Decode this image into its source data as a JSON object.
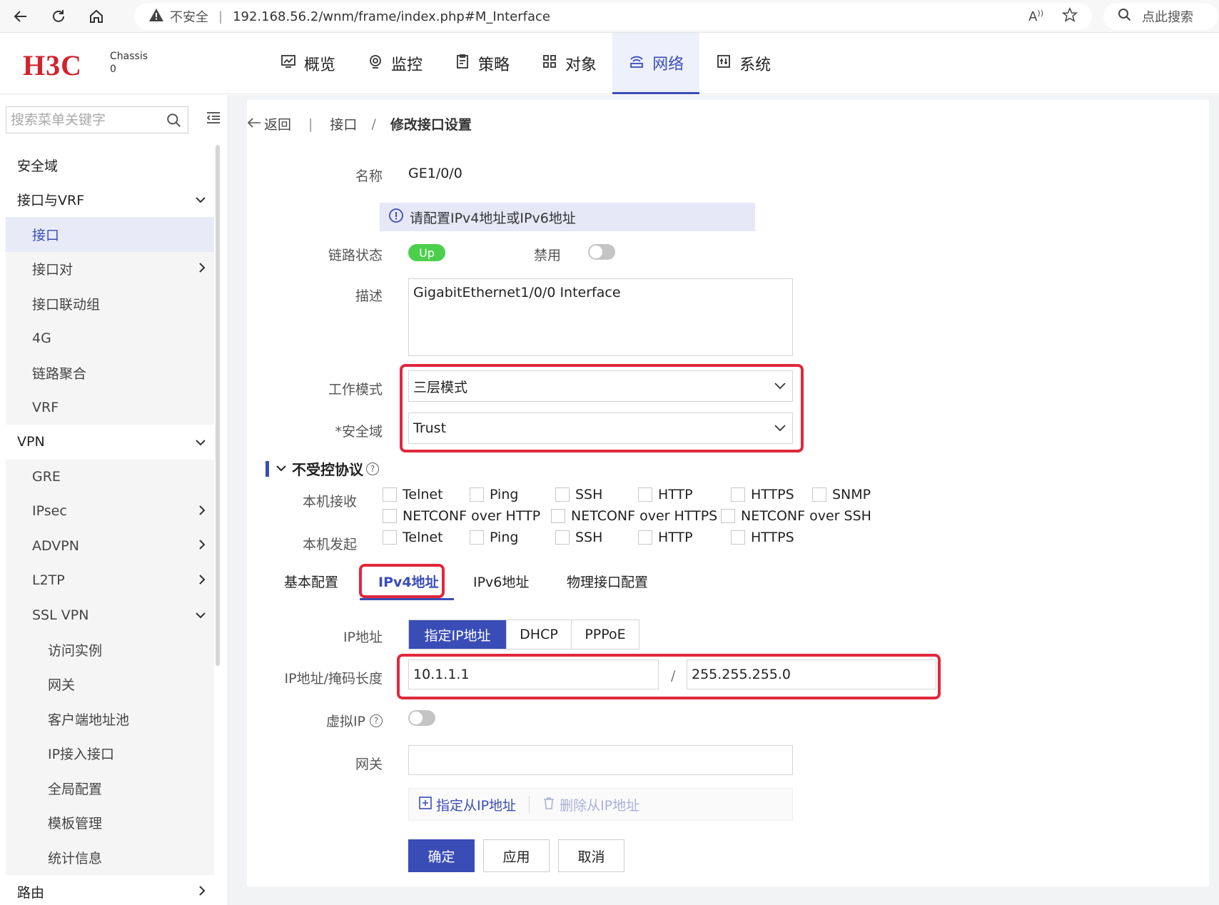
{
  "browser": {
    "insecure_label": "不安全",
    "url": "192.168.56.2/wnm/frame/index.php#M_Interface",
    "search_label": "点此搜索"
  },
  "header": {
    "logo": "H3C",
    "chassis_label": "Chassis",
    "chassis_value": "0",
    "nav": [
      {
        "label": "概览",
        "icon": "chart-icon"
      },
      {
        "label": "监控",
        "icon": "monitor-icon"
      },
      {
        "label": "策略",
        "icon": "policy-icon"
      },
      {
        "label": "对象",
        "icon": "grid-icon"
      },
      {
        "label": "网络",
        "icon": "network-icon",
        "active": true
      },
      {
        "label": "系统",
        "icon": "system-icon"
      }
    ]
  },
  "sidebar": {
    "search_placeholder": "搜索菜单关键字",
    "items": [
      {
        "label": "安全域",
        "level": 1
      },
      {
        "label": "接口与VRF",
        "level": 1,
        "chevron": "down"
      },
      {
        "label": "接口",
        "level": 2,
        "active": true
      },
      {
        "label": "接口对",
        "level": 2,
        "chevron": "right"
      },
      {
        "label": "接口联动组",
        "level": 2
      },
      {
        "label": "4G",
        "level": 2
      },
      {
        "label": "链路聚合",
        "level": 2
      },
      {
        "label": "VRF",
        "level": 2
      },
      {
        "label": "VPN",
        "level": 1,
        "chevron": "down"
      },
      {
        "label": "GRE",
        "level": 2
      },
      {
        "label": "IPsec",
        "level": 2,
        "chevron": "right"
      },
      {
        "label": "ADVPN",
        "level": 2,
        "chevron": "right"
      },
      {
        "label": "L2TP",
        "level": 2,
        "chevron": "right"
      },
      {
        "label": "SSL VPN",
        "level": 2,
        "chevron": "down"
      },
      {
        "label": "访问实例",
        "level": 3
      },
      {
        "label": "网关",
        "level": 3
      },
      {
        "label": "客户端地址池",
        "level": 3
      },
      {
        "label": "IP接入接口",
        "level": 3
      },
      {
        "label": "全局配置",
        "level": 3
      },
      {
        "label": "模板管理",
        "level": 3
      },
      {
        "label": "统计信息",
        "level": 3
      },
      {
        "label": "路由",
        "level": 1,
        "chevron": "right"
      }
    ]
  },
  "breadcrumb": {
    "back": "返回",
    "parent": "接口",
    "separator": "/",
    "current": "修改接口设置"
  },
  "form": {
    "name_label": "名称",
    "name_value": "GE1/0/0",
    "info_message": "请配置IPv4地址或IPv6地址",
    "link_state_label": "链路状态",
    "link_state_value": "Up",
    "disable_label": "禁用",
    "desc_label": "描述",
    "desc_value": "GigabitEthernet1/0/0 Interface",
    "work_mode_label": "工作模式",
    "work_mode_value": "三层模式",
    "zone_label": "*安全域",
    "zone_value": "Trust",
    "section_title": "不受控协议",
    "local_receive_label": "本机接收",
    "local_receive_row1": [
      "Telnet",
      "Ping",
      "SSH",
      "HTTP",
      "HTTPS",
      "SNMP"
    ],
    "local_receive_row2": [
      "NETCONF over HTTP",
      "NETCONF over HTTPS",
      "NETCONF over SSH"
    ],
    "local_send_label": "本机发起",
    "local_send_row": [
      "Telnet",
      "Ping",
      "SSH",
      "HTTP",
      "HTTPS"
    ]
  },
  "tabs": [
    "基本配置",
    "IPv4地址",
    "IPv6地址",
    "物理接口配置"
  ],
  "ipv4": {
    "ip_label": "IP地址",
    "modes": [
      "指定IP地址",
      "DHCP",
      "PPPoE"
    ],
    "ip_mask_label": "IP地址/掩码长度",
    "ip_value": "10.1.1.1",
    "slash": "/",
    "mask_value": "255.255.255.0",
    "virtual_ip_label": "虚拟IP",
    "gateway_label": "网关",
    "gateway_value": "",
    "add_sub_ip": "指定从IP地址",
    "del_sub_ip": "删除从IP地址"
  },
  "buttons": {
    "ok": "确定",
    "apply": "应用",
    "cancel": "取消"
  },
  "colors": {
    "accent": "#3a4db7",
    "highlight": "#e0283c",
    "status_up": "#4ccf4c",
    "brand": "#d0232e"
  }
}
